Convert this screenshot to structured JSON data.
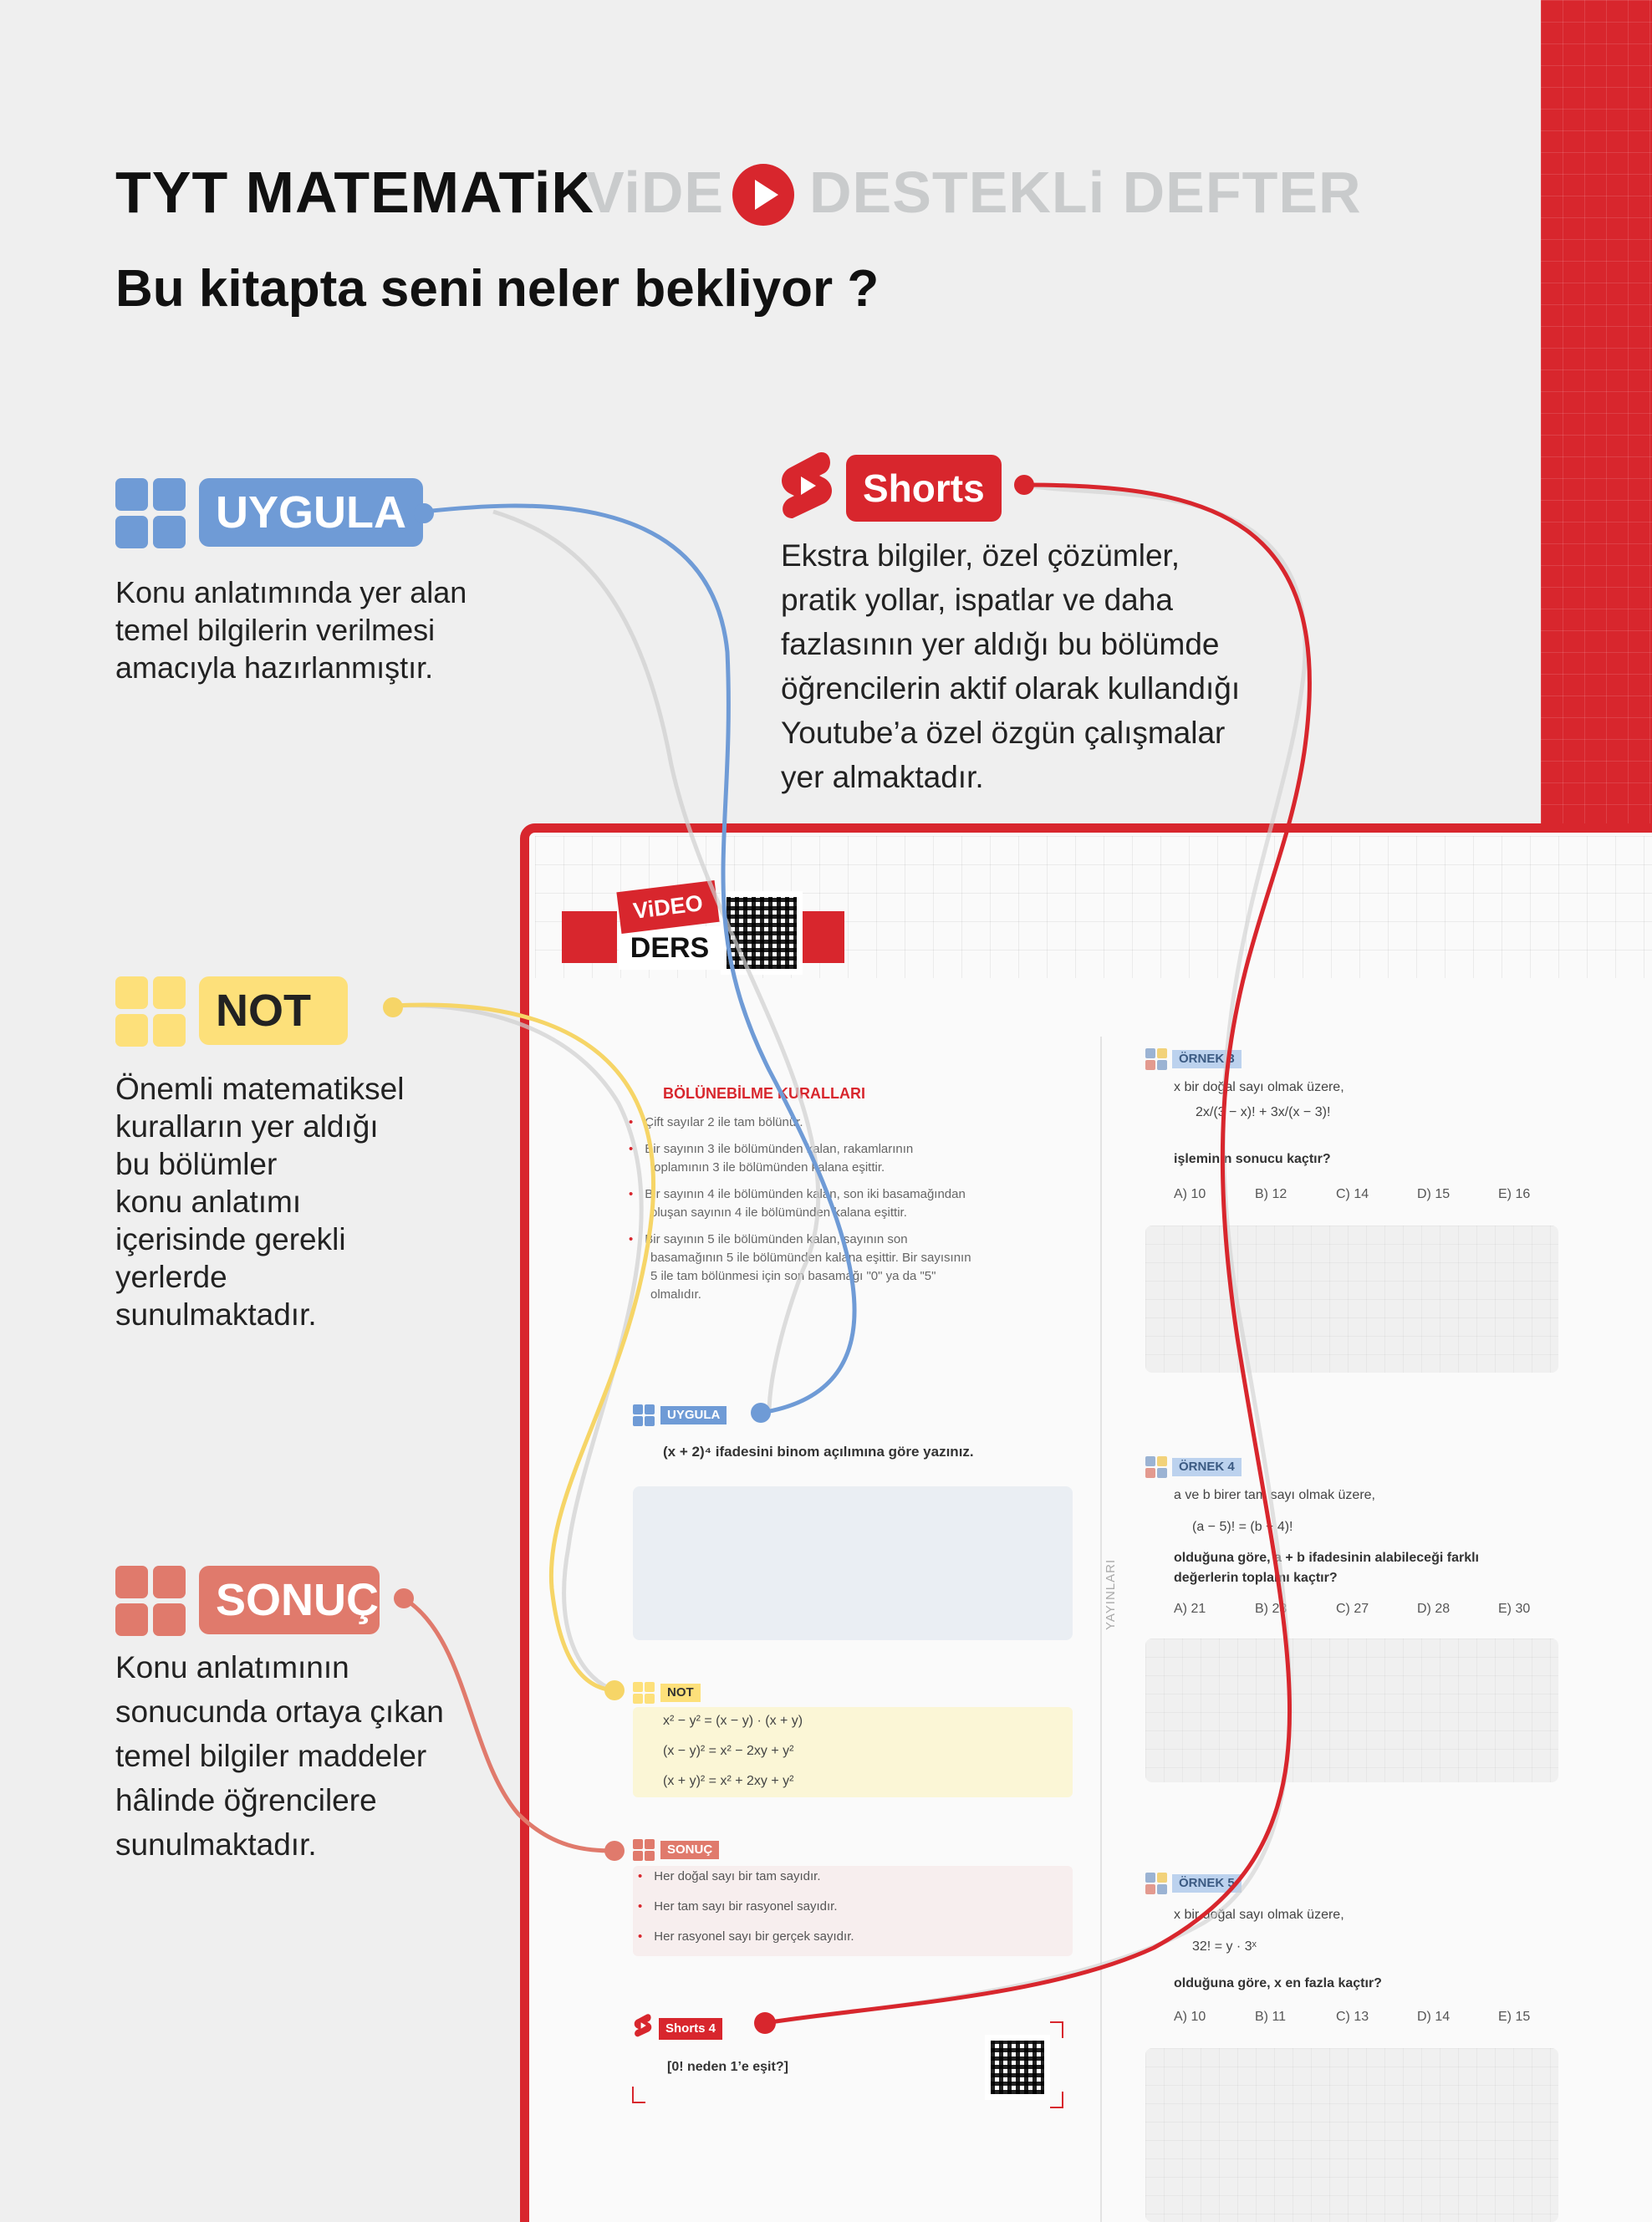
{
  "header": {
    "title_black": "TYT  MATEMATiK",
    "title_grey_left": "ViDE",
    "title_grey_right": "DESTEKLi DEFTER",
    "subtitle_light": "Bu kitapta seni",
    "subtitle_bold": "neler bekliyor ?"
  },
  "sections": {
    "uygula": {
      "tag": "UYGULA",
      "color": "#6f9bd6",
      "desc": [
        "Konu anlatımında yer alan",
        "temel bilgilerin verilmesi",
        "amacıyla hazırlanmıştır."
      ]
    },
    "shorts": {
      "tag": "Shorts",
      "color": "#d8262d",
      "desc": [
        "Ekstra bilgiler, özel çözümler,",
        "pratik yollar, ispatlar ve daha",
        "fazlasının yer aldığı bu bölümde",
        "öğrencilerin aktif olarak kullandığı",
        "Youtube’a özel özgün çalışmalar",
        "yer almaktadır."
      ]
    },
    "not": {
      "tag": "NOT",
      "color": "#fde07a",
      "desc": [
        "Önemli matematiksel",
        "kuralların yer aldığı",
        "bu bölümler",
        "konu anlatımı",
        "içerisinde gerekli",
        "yerlerde",
        "sunulmaktadır."
      ]
    },
    "sonuc": {
      "tag": "SONUÇ",
      "color": "#e07a6c",
      "desc": [
        "Konu anlatımının",
        "sonucunda ortaya çıkan",
        "temel bilgiler maddeler",
        "hâlinde öğrencilere",
        "sunulmaktadır."
      ]
    }
  },
  "notebook": {
    "video_badge": "ViDEO",
    "ders_label": "DERS",
    "section_title": "BÖLÜNEBİLME KURALLARI",
    "bullets": [
      [
        "Çift sayılar 2 ile tam bölünür."
      ],
      [
        "Bir sayının 3 ile bölümünden kalan, rakamlarının",
        "toplamının 3 ile bölümünden kalana eşittir."
      ],
      [
        "Bir sayının 4 ile bölümünden kalan, son iki basamağından",
        "oluşan sayının 4 ile bölümünden kalana eşittir."
      ],
      [
        "Bir sayının 5 ile bölümünden kalan, sayının son",
        "basamağının 5 ile bölümünden kalana eşittir. Bir sayısının",
        "5 ile tam bölünmesi için son basamağı \"0\" ya da \"5\"",
        "olmalıdır."
      ]
    ],
    "uygula_tag": "UYGULA",
    "uygula_question": "(x + 2)⁴ ifadesini binom açılımına göre yazınız.",
    "not_tag": "NOT",
    "not_lines": [
      "x² − y² = (x − y) · (x + y)",
      "(x − y)² = x² − 2xy + y²",
      "(x + y)² = x² + 2xy + y²"
    ],
    "sonuc_tag": "SONUÇ",
    "sonuc_lines": [
      "Her doğal sayı bir tam sayıdır.",
      "Her tam sayı bir rasyonel sayıdır.",
      "Her rasyonel sayı bir gerçek sayıdır."
    ],
    "shorts_tag": "Shorts 4",
    "shorts_question": "[0! neden 1’e eşit?]",
    "publisher_vertical": "YAYINLARI",
    "examples": [
      {
        "tag": "ÖRNEK 3",
        "lines": [
          "x bir doğal sayı olmak üzere,"
        ],
        "formula": "2x/(3 − x)! + 3x/(x − 3)!",
        "question": "işleminin sonucu kaçtır?",
        "choices": [
          "A) 10",
          "B) 12",
          "C) 14",
          "D) 15",
          "E) 16"
        ]
      },
      {
        "tag": "ÖRNEK 4",
        "lines": [
          "a ve b birer tam sayı olmak üzere,"
        ],
        "formula": "(a − 5)! = (b + 4)!",
        "question": "olduğuna göre, a + b ifadesinin alabileceği farklı değerlerin toplamı kaçtır?",
        "choices": [
          "A) 21",
          "B) 23",
          "C) 27",
          "D) 28",
          "E) 30"
        ]
      },
      {
        "tag": "ÖRNEK 5",
        "lines": [
          "x bir doğal sayı olmak üzere,"
        ],
        "formula": "32! = y · 3ˣ",
        "question": "olduğuna göre, x en fazla kaçtır?",
        "choices": [
          "A) 10",
          "B) 11",
          "C) 13",
          "D) 14",
          "E) 15"
        ]
      }
    ]
  }
}
